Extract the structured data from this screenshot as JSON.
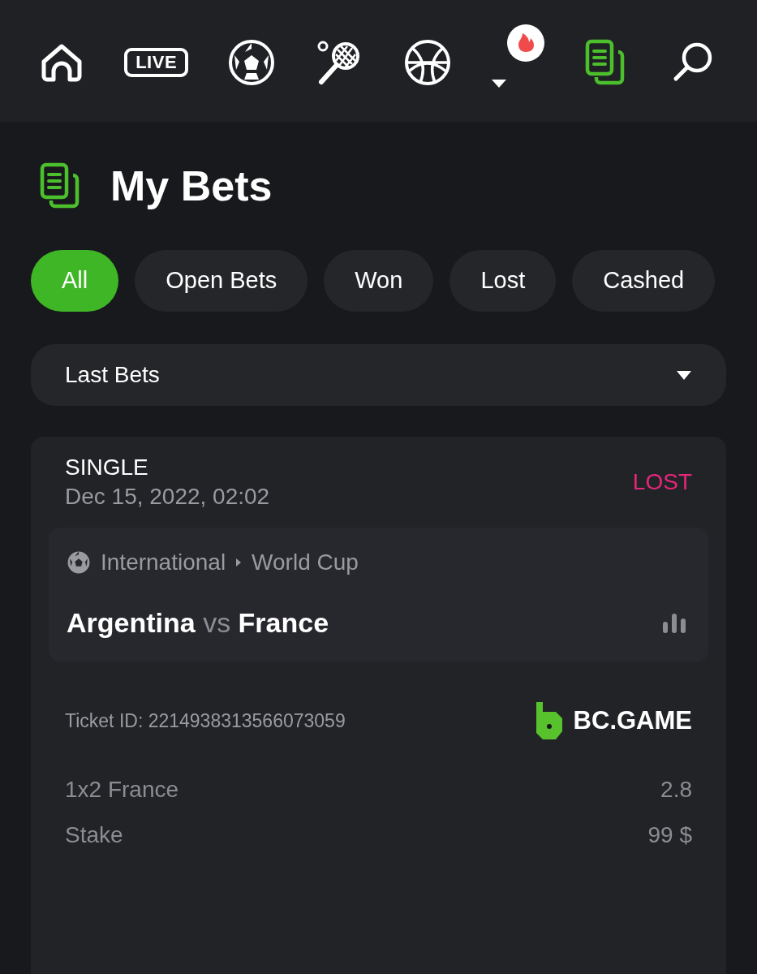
{
  "nav": [
    {
      "kind": "home",
      "selected": false
    },
    {
      "kind": "live",
      "label": "LIVE",
      "selected": false
    },
    {
      "kind": "soccer",
      "selected": false
    },
    {
      "kind": "tennis",
      "selected": false
    },
    {
      "kind": "basketball",
      "selected": false
    },
    {
      "kind": "more",
      "selected": false
    },
    {
      "kind": "bets",
      "selected": true
    },
    {
      "kind": "search",
      "selected": false
    }
  ],
  "page_title": "My Bets",
  "filters": [
    {
      "label": "All",
      "selected": true
    },
    {
      "label": "Open Bets",
      "selected": false
    },
    {
      "label": "Won",
      "selected": false
    },
    {
      "label": "Lost",
      "selected": false
    },
    {
      "label": "Cashed",
      "selected": false
    }
  ],
  "period_select": {
    "value": "Last Bets"
  },
  "bet": {
    "type": "SINGLE",
    "date": "Dec 15, 2022, 02:02",
    "status": {
      "label": "LOST",
      "kind": "lost"
    },
    "league": [
      "International",
      "World Cup"
    ],
    "home": "Argentina",
    "vs": "vs",
    "away": "France",
    "ticket_id": "Ticket ID: 2214938313566073059",
    "brand": "BC.GAME",
    "rows": [
      {
        "label": "1x2 France",
        "value": "2.8"
      },
      {
        "label": "Stake",
        "value": "99 $"
      }
    ]
  }
}
